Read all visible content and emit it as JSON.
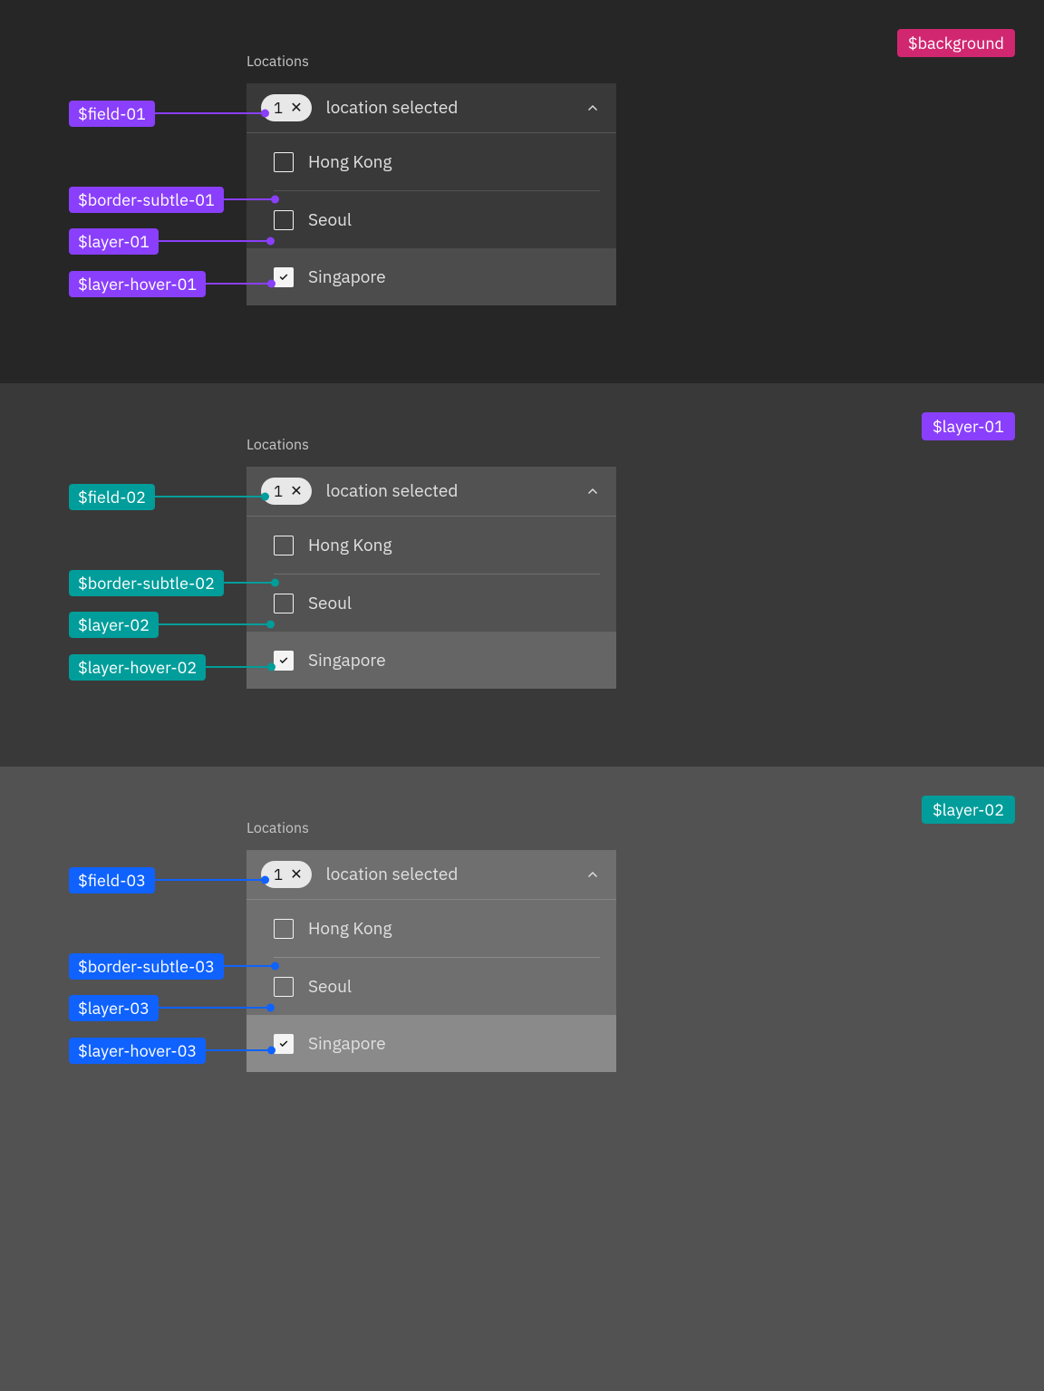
{
  "colors": {
    "purple": "#8a3ffc",
    "teal": "#009d9a",
    "blue": "#0f62fe",
    "magenta": "#d12771",
    "panel1_bg": "#262626",
    "panel2_bg": "#393939",
    "panel3_bg": "#525252",
    "field_01": "#393939",
    "field_02": "#525252",
    "field_03": "#6f6f6f",
    "layer_01": "#393939",
    "layer_02": "#525252",
    "layer_03": "#6f6f6f",
    "layer_hover_01": "#4c4c4c",
    "layer_hover_02": "#656565",
    "layer_hover_03": "#8a8a8a",
    "border_subtle_01": "#525252",
    "border_subtle_02": "#6f6f6f",
    "border_subtle_03": "#8d8d8d"
  },
  "dropdown": {
    "label": "Locations",
    "count": "1",
    "clear_glyph": "✕",
    "placeholder": "location selected",
    "options": [
      "Hong Kong",
      "Seoul",
      "Singapore"
    ]
  },
  "corner_tags": {
    "panel1": "$background",
    "panel2": "$layer-01",
    "panel3": "$layer-02"
  },
  "tokens": {
    "set1": {
      "field": "$field-01",
      "border": "$border-subtle-01",
      "layer": "$layer-01",
      "hover": "$layer-hover-01"
    },
    "set2": {
      "field": "$field-02",
      "border": "$border-subtle-02",
      "layer": "$layer-02",
      "hover": "$layer-hover-02"
    },
    "set3": {
      "field": "$field-03",
      "border": "$border-subtle-03",
      "layer": "$layer-03",
      "hover": "$layer-hover-03"
    }
  }
}
